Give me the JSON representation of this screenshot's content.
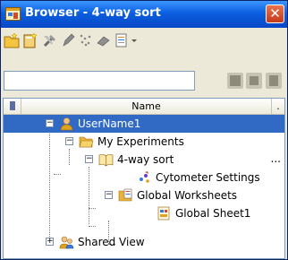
{
  "window": {
    "title": "Browser - 4-way sort",
    "close_glyph": "✕"
  },
  "toolbar": {
    "buttons": [
      "new-folder-icon",
      "new-experiment-icon",
      "tools-icon",
      "pen-icon",
      "gate-icon",
      "eraser-icon",
      "document-icon"
    ]
  },
  "search": {
    "value": "",
    "placeholder": ""
  },
  "tree": {
    "header": {
      "name_label": "Name",
      "extra_label": "."
    },
    "nodes": [
      {
        "label": "UserName1",
        "icon": "user-icon",
        "expander": "−",
        "selected": true
      },
      {
        "label": "My Experiments",
        "icon": "folder-open-icon",
        "expander": "−"
      },
      {
        "label": "4-way sort",
        "icon": "experiment-book-icon",
        "expander": "−",
        "trailing": "..."
      },
      {
        "label": "Cytometer Settings",
        "icon": "cytometer-settings-icon"
      },
      {
        "label": "Global Worksheets",
        "icon": "worksheets-folder-icon",
        "expander": "−"
      },
      {
        "label": "Global Sheet1",
        "icon": "worksheet-icon"
      },
      {
        "label": "Shared View",
        "icon": "shared-users-icon",
        "expander": "+"
      }
    ]
  },
  "colors": {
    "titlebar": "#0a5fe0",
    "selection": "#316ac5",
    "close_button": "#d4512c"
  }
}
